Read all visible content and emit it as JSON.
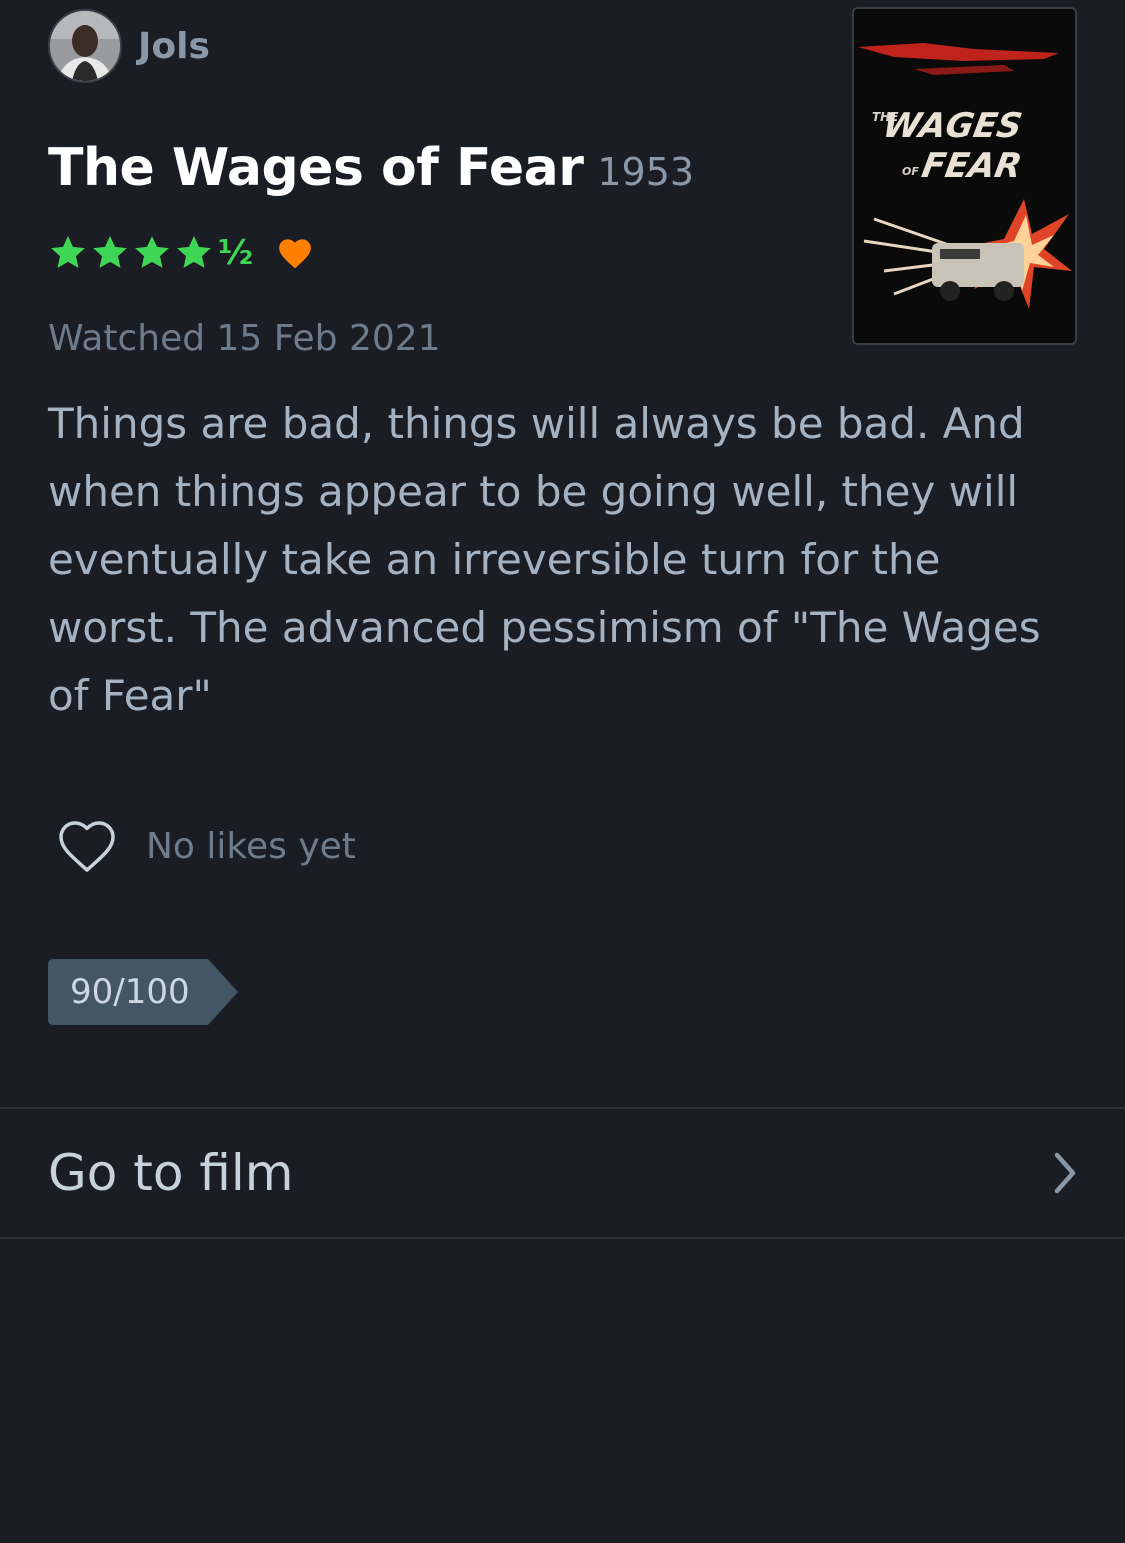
{
  "author": {
    "name": "Jols",
    "avatar_icon": "user-avatar"
  },
  "film": {
    "title": "The Wages of Fear",
    "year": "1953",
    "poster": {
      "text_the": "THE",
      "text_wages": "WAGES",
      "text_of": "OF",
      "text_fear": "FEAR"
    }
  },
  "rating": {
    "stars": 4.5,
    "max": 5,
    "half_symbol": "½",
    "liked": true,
    "star_color": "#40d655",
    "heart_color": "#ff8000"
  },
  "watched": {
    "label": "Watched 15 Feb 2021"
  },
  "review": {
    "text": "Things are bad, things will always be bad. And when things appear to be going well, they will eventually take an irreversible turn for the worst. The advanced pessimism of \"The Wages of Fear\""
  },
  "likes": {
    "label": "No likes yet",
    "icon": "heart-outline-icon"
  },
  "tag": {
    "label": "90/100"
  },
  "navigation": {
    "go_to_film": "Go to film",
    "icon": "chevron-right-icon"
  }
}
